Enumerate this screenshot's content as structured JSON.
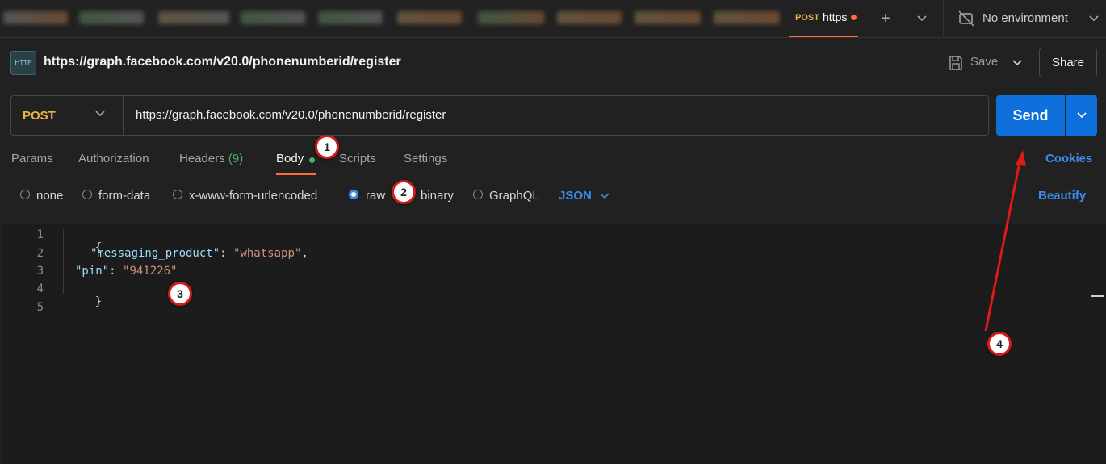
{
  "tabs": {
    "active": {
      "method": "POST",
      "title": "https"
    },
    "new_tab_symbol": "+",
    "environment": "No environment"
  },
  "request": {
    "name": "https://graph.facebook.com/v20.0/phonenumberid/register",
    "http_icon_label": "HTTP",
    "save_label": "Save",
    "share_label": "Share",
    "method": "POST",
    "url": "https://graph.facebook.com/v20.0/phonenumberid/register",
    "send_label": "Send"
  },
  "request_tabs": {
    "params": "Params",
    "authorization": "Authorization",
    "headers": "Headers",
    "headers_count": "(9)",
    "body": "Body",
    "scripts": "Scripts",
    "settings": "Settings",
    "cookies": "Cookies"
  },
  "body_options": {
    "none": "none",
    "form_data": "form-data",
    "urlencoded": "x-www-form-urlencoded",
    "raw": "raw",
    "binary": "binary",
    "graphql": "GraphQL",
    "selected": "raw",
    "format": "JSON",
    "beautify": "Beautify"
  },
  "editor": {
    "line_numbers": [
      "1",
      "2",
      "3",
      "4",
      "5"
    ],
    "open_brace": "{",
    "close_brace": "}",
    "line2": {
      "key": "\"messaging_product\"",
      "colon": ": ",
      "value": "\"whatsapp\"",
      "comma": ","
    },
    "line3": {
      "key": "\"pin\"",
      "colon": ": ",
      "value": "\"941226\""
    }
  },
  "annotations": [
    "1",
    "2",
    "3",
    "4"
  ],
  "colors": {
    "accent": "#ff6c37",
    "method_post": "#eab447",
    "send_blue": "#0f6fdb",
    "link_blue": "#3b8be9",
    "annotation_red": "#d31b1b"
  }
}
